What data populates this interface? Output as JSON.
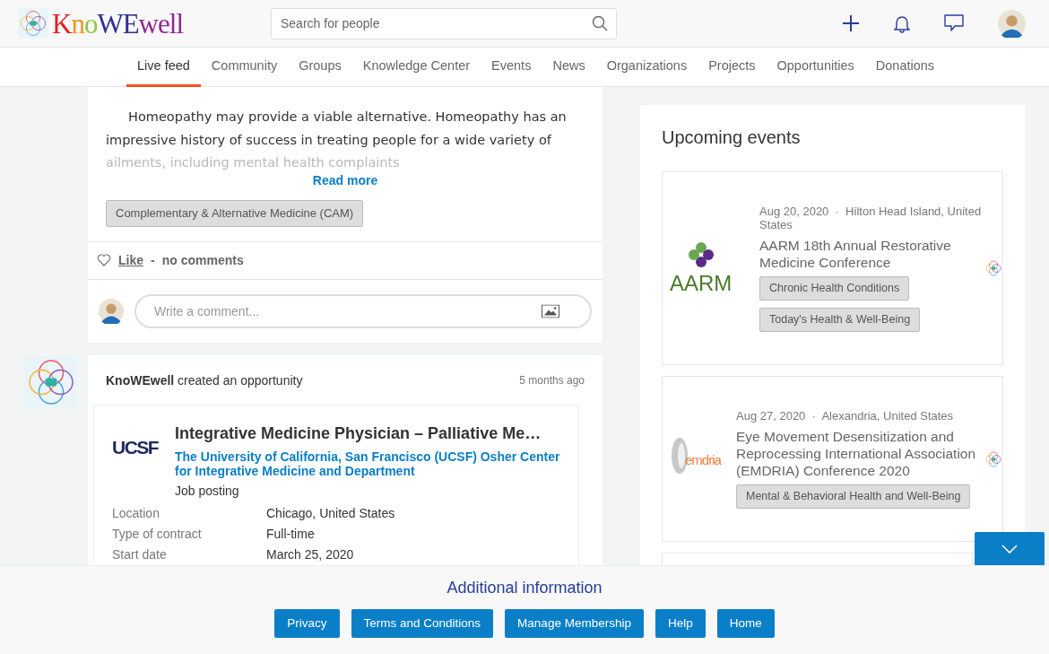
{
  "header": {
    "brand": "KnoWEwell",
    "search": {
      "placeholder": "Search for people"
    }
  },
  "nav": [
    {
      "label": "Live feed",
      "selected": true
    },
    {
      "label": "Community",
      "selected": false
    },
    {
      "label": "Groups",
      "selected": false
    },
    {
      "label": "Knowledge Center",
      "selected": false
    },
    {
      "label": "Events",
      "selected": false
    },
    {
      "label": "News",
      "selected": false
    },
    {
      "label": "Organizations",
      "selected": false
    },
    {
      "label": "Projects",
      "selected": false
    },
    {
      "label": "Opportunities",
      "selected": false
    },
    {
      "label": "Donations",
      "selected": false
    }
  ],
  "feed": [
    {
      "kind": "post",
      "paragraph": "Homeopathy may provide a viable alternative. Homeopathy has an impressive history of success in treating people for a wide variety of",
      "faded_line": "ailments, including mental health complaints",
      "read_more": "Read more",
      "tags": [
        "Complementary & Alternative Medicine (CAM)"
      ],
      "like": "Like",
      "separator": "-",
      "comments": "no comments",
      "comment_placeholder": "Write a comment..."
    },
    {
      "kind": "opportunity",
      "author_line": "**KnoWEwell** created an opportunity",
      "time": "5 months ago",
      "logo_text": "UCSF",
      "title": "Integrative Medicine Physician – Palliative Me…",
      "organization": "The University of California, San Francisco (UCSF) Osher Center for Integrative Medicine and Department",
      "type": "Job posting",
      "details": [
        {
          "label": "Location",
          "value": "Chicago, United States"
        },
        {
          "label": "Type of contract",
          "value": "Full-time"
        },
        {
          "label": "Start date",
          "value": "March 25, 2020"
        }
      ]
    }
  ],
  "events": {
    "title": "Upcoming events",
    "items": [
      {
        "logo_text": "AARM",
        "meta": "Aug 20, 2020  ·  Hilton Head Island, United States",
        "title": "AARM 18th Annual Restorative Medicine Conference",
        "tags": [
          "Chronic Health Conditions",
          "Today's Health & Well-Being"
        ]
      },
      {
        "logo_text": "emdria",
        "meta": "Aug 27, 2020  ·  Alexandria, United States",
        "title": "Eye Movement Desensitization and Reprocessing International Association (EMDRIA) Conference 2020",
        "tags": [
          "Mental & Behavioral Health and Well-Being"
        ]
      }
    ]
  },
  "footer": {
    "title": "Additional information",
    "links": [
      "Privacy",
      "Terms and Conditions",
      "Manage Membership",
      "Help",
      "Home"
    ]
  }
}
